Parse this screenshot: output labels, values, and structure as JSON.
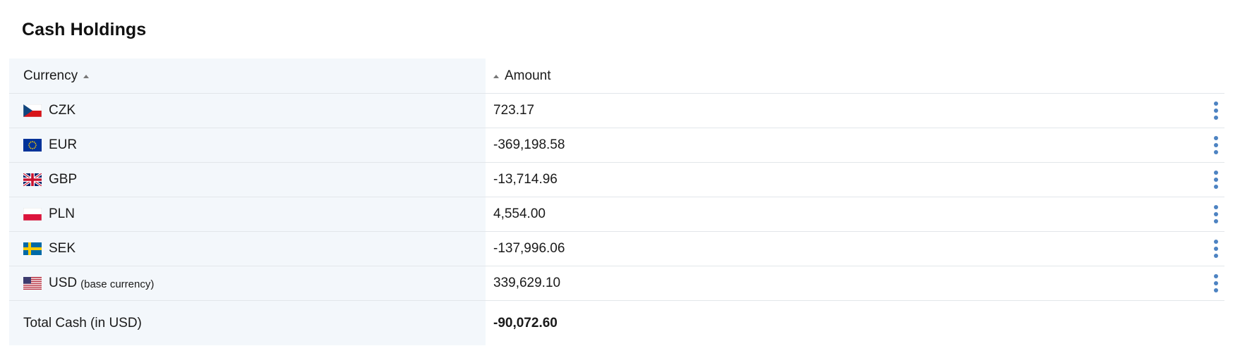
{
  "title": "Cash Holdings",
  "columns": {
    "currency": "Currency",
    "amount": "Amount"
  },
  "rows": [
    {
      "code": "CZK",
      "suffix": "",
      "amount": "723.17",
      "flag": "czech-flag-icon"
    },
    {
      "code": "EUR",
      "suffix": "",
      "amount": "-369,198.58",
      "flag": "eu-flag-icon"
    },
    {
      "code": "GBP",
      "suffix": "",
      "amount": "-13,714.96",
      "flag": "uk-flag-icon"
    },
    {
      "code": "PLN",
      "suffix": "",
      "amount": "4,554.00",
      "flag": "poland-flag-icon"
    },
    {
      "code": "SEK",
      "suffix": "",
      "amount": "-137,996.06",
      "flag": "sweden-flag-icon"
    },
    {
      "code": "USD",
      "suffix": "(base currency)",
      "amount": "339,629.10",
      "flag": "us-flag-icon"
    }
  ],
  "total": {
    "label": "Total Cash (in USD)",
    "amount": "-90,072.60"
  },
  "colors": {
    "header_bg": "#f3f7fb",
    "kebab": "#4d83c2",
    "divider": "#e2e6ea"
  }
}
